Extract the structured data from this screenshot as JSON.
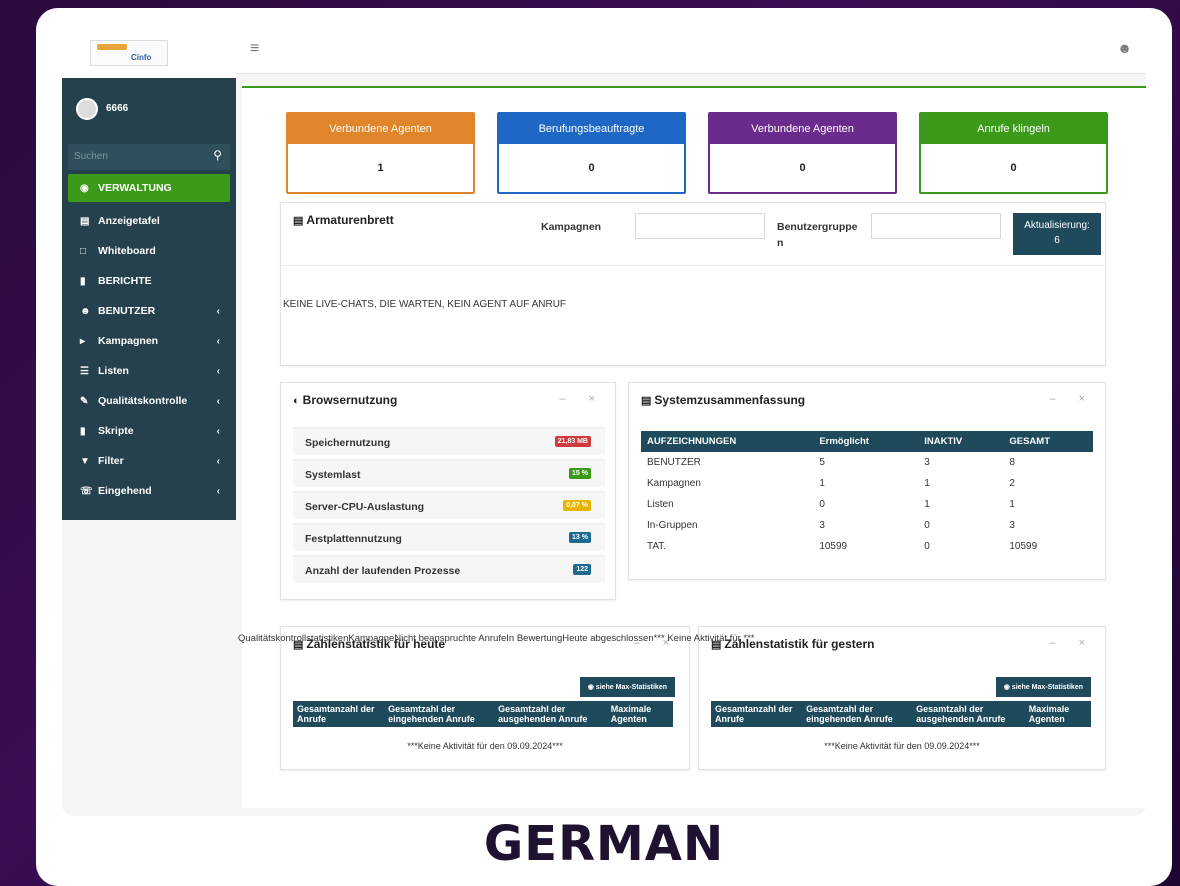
{
  "header": {
    "menu_icon": "hamburger-icon",
    "user_icon": "user-icon"
  },
  "sidebar": {
    "user": "6666",
    "search_placeholder": "Suchen",
    "items": [
      {
        "label": "VERWALTUNG",
        "icon": "dashboard-icon",
        "active": true
      },
      {
        "label": "Anzeigetafel",
        "icon": "chart-icon"
      },
      {
        "label": "Whiteboard",
        "icon": "square-icon"
      },
      {
        "label": "BERICHTE",
        "icon": "file-icon"
      },
      {
        "label": "BENUTZER",
        "icon": "user-icon",
        "chevron": true
      },
      {
        "label": "Kampagnen",
        "icon": "megaphone-icon",
        "chevron": true
      },
      {
        "label": "Listen",
        "icon": "list-icon",
        "chevron": true
      },
      {
        "label": "Qualitätskontrolle",
        "icon": "edit-icon",
        "chevron": true
      },
      {
        "label": "Skripte",
        "icon": "file-icon",
        "chevron": true
      },
      {
        "label": "Filter",
        "icon": "filter-icon",
        "chevron": true
      },
      {
        "label": "Eingehend",
        "icon": "phone-icon",
        "chevron": true
      }
    ]
  },
  "kpis": [
    {
      "title": "Verbundene Agenten",
      "value": "1",
      "color": "#e0852a"
    },
    {
      "title": "Berufungsbeauftragte",
      "value": "0",
      "color": "#1f67c4"
    },
    {
      "title": "Verbundene Agenten",
      "value": "0",
      "color": "#6a2b8c"
    },
    {
      "title": "Anrufe klingeln",
      "value": "0",
      "color": "#3c9a1b"
    }
  ],
  "dashboard": {
    "title": "Armaturenbrett",
    "campaigns_label": "Kampagnen",
    "usergroups_label_1": "Benutzergruppe",
    "usergroups_label_2": "n",
    "refresh_label_1": "Aktualisierung:",
    "refresh_label_2": "6",
    "message": "KEINE LIVE-CHATS, DIE WARTEN, KEIN AGENT AUF ANRUF"
  },
  "browser": {
    "title": "Browsernutzung",
    "rows": [
      {
        "label": "Speichernutzung",
        "badge": "21,83 MB",
        "color": "#d23b3b"
      },
      {
        "label": "Systemlast",
        "badge": "15 %",
        "color": "#3c9a1b"
      },
      {
        "label": "Server-CPU-Auslastung",
        "badge": "0,07 %",
        "color": "#e8b400"
      },
      {
        "label": "Festplattennutzung",
        "badge": "13 %",
        "color": "#1e6a8c"
      },
      {
        "label": "Anzahl der laufenden Prozesse",
        "badge": "122",
        "color": "#1e6a8c"
      }
    ]
  },
  "system": {
    "title": "Systemzusammenfassung",
    "headers": [
      "AUFZEICHNUNGEN",
      "Ermöglicht",
      "INAKTIV",
      "GESAMT"
    ],
    "rows": [
      [
        "BENUTZER",
        "5",
        "3",
        "8"
      ],
      [
        "Kampagnen",
        "1",
        "1",
        "2"
      ],
      [
        "Listen",
        "0",
        "1",
        "1"
      ],
      [
        "In-Gruppen",
        "3",
        "0",
        "3"
      ],
      [
        "TAT.",
        "10599",
        "0",
        "10599"
      ]
    ]
  },
  "caption": "QualitätskontrollstatistikenKampagneNicht beanspruchte AnrufeIn BewertungHeute abgeschlossen*** Keine Aktivität für ***",
  "stats_today": {
    "title": "Zahlenstatistik für heute",
    "button": "siehe Max-Statistiken",
    "headers": [
      "Gesamtanzahl der Anrufe",
      "Gesamtzahl der eingehenden Anrufe",
      "Gesamtzahl der ausgehenden Anrufe",
      "Maximale Agenten"
    ],
    "empty": "***Keine Aktivität für den 09.09.2024***"
  },
  "stats_yesterday": {
    "title": "Zahlenstatistik für gestern",
    "button": "siehe Max-Statistiken",
    "headers": [
      "Gesamtanzahl der Anrufe",
      "Gesamtzahl der eingehenden Anrufe",
      "Gesamtzahl der ausgehenden Anrufe",
      "Maximale Agenten"
    ],
    "empty": "***Keine Aktivität für den 09.09.2024***"
  },
  "footer_title": "GERMAN"
}
